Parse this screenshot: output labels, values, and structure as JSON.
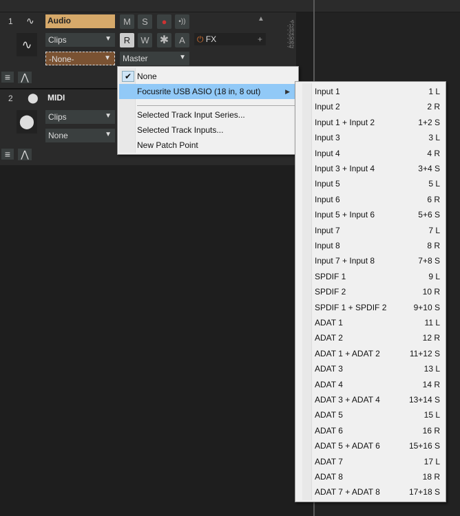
{
  "tracks": [
    {
      "number": "1",
      "name": "Audio",
      "clips": "Clips",
      "input": "-None-",
      "output": "Master",
      "fx": "FX",
      "buttons": [
        "M",
        "S",
        "R",
        "W",
        "A"
      ]
    },
    {
      "number": "2",
      "name": "MIDI",
      "clips": "Clips",
      "input": "None"
    }
  ],
  "meter_ticks": [
    "-6",
    "-12",
    "-18",
    "-24",
    "-30",
    "-36",
    "-42"
  ],
  "input_menu": {
    "items": [
      "None",
      "Focusrite USB ASIO (18 in, 8 out)",
      "Selected Track Input Series...",
      "Selected Track Inputs...",
      "New Patch Point"
    ]
  },
  "submenu": [
    {
      "label": "Input 1",
      "shortcut": "1 L"
    },
    {
      "label": "Input 2",
      "shortcut": "2 R"
    },
    {
      "label": "Input 1 + Input 2",
      "shortcut": "1+2 S"
    },
    {
      "label": "Input 3",
      "shortcut": "3 L"
    },
    {
      "label": "Input 4",
      "shortcut": "4 R"
    },
    {
      "label": "Input 3 + Input 4",
      "shortcut": "3+4 S"
    },
    {
      "label": "Input 5",
      "shortcut": "5 L"
    },
    {
      "label": "Input 6",
      "shortcut": "6 R"
    },
    {
      "label": "Input 5 + Input 6",
      "shortcut": "5+6 S"
    },
    {
      "label": "Input 7",
      "shortcut": "7 L"
    },
    {
      "label": "Input 8",
      "shortcut": "8 R"
    },
    {
      "label": "Input 7 + Input 8",
      "shortcut": "7+8 S"
    },
    {
      "label": "SPDIF 1",
      "shortcut": "9 L"
    },
    {
      "label": "SPDIF 2",
      "shortcut": "10 R"
    },
    {
      "label": "SPDIF 1 + SPDIF 2",
      "shortcut": "9+10 S"
    },
    {
      "label": "ADAT 1",
      "shortcut": "11 L"
    },
    {
      "label": "ADAT 2",
      "shortcut": "12 R"
    },
    {
      "label": "ADAT 1 + ADAT 2",
      "shortcut": "11+12 S"
    },
    {
      "label": "ADAT 3",
      "shortcut": "13 L"
    },
    {
      "label": "ADAT 4",
      "shortcut": "14 R"
    },
    {
      "label": "ADAT 3 + ADAT 4",
      "shortcut": "13+14 S"
    },
    {
      "label": "ADAT 5",
      "shortcut": "15 L"
    },
    {
      "label": "ADAT 6",
      "shortcut": "16 R"
    },
    {
      "label": "ADAT 5 + ADAT 6",
      "shortcut": "15+16 S"
    },
    {
      "label": "ADAT 7",
      "shortcut": "17 L"
    },
    {
      "label": "ADAT 8",
      "shortcut": "18 R"
    },
    {
      "label": "ADAT 7 + ADAT 8",
      "shortcut": "17+18 S"
    }
  ]
}
